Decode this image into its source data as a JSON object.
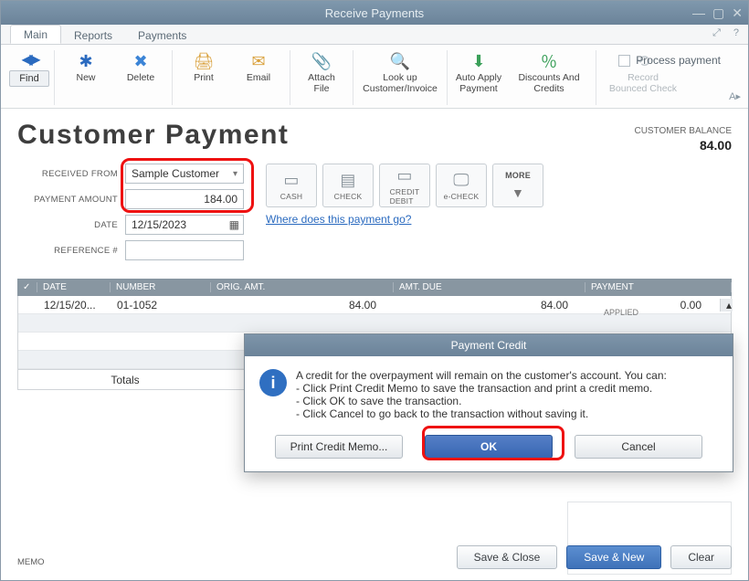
{
  "window": {
    "title": "Receive Payments"
  },
  "tabs": {
    "items": [
      "Main",
      "Reports",
      "Payments"
    ],
    "active": "Main"
  },
  "ribbon": {
    "find": "Find",
    "new": "New",
    "delete": "Delete",
    "print": "Print",
    "email": "Email",
    "attach": "Attach\nFile",
    "lookup": "Look up\nCustomer/Invoice",
    "autoapply": "Auto Apply\nPayment",
    "discounts": "Discounts And\nCredits",
    "record": "Record\nBounced Check",
    "process_payment": "Process payment"
  },
  "header": {
    "title": "Customer Payment",
    "balance_label": "CUSTOMER BALANCE",
    "balance_value": "84.00"
  },
  "form": {
    "received_from_label": "RECEIVED FROM",
    "received_from_value": "Sample Customer",
    "payment_amount_label": "PAYMENT AMOUNT",
    "payment_amount_value": "184.00",
    "date_label": "DATE",
    "date_value": "12/15/2023",
    "reference_label": "REFERENCE #",
    "reference_value": ""
  },
  "pay_methods": {
    "cash": "CASH",
    "check": "CHECK",
    "credit": "CREDIT\nDEBIT",
    "echeck": "e-CHECK",
    "more": "MORE"
  },
  "paylink": "Where does this payment go?",
  "grid": {
    "cols": {
      "check": "✓",
      "date": "DATE",
      "number": "NUMBER",
      "orig": "ORIG. AMT.",
      "due": "AMT. DUE",
      "payment": "PAYMENT"
    },
    "rows": [
      {
        "date": "12/15/20...",
        "number": "01-1052",
        "orig": "84.00",
        "due": "84.00",
        "payment": "0.00"
      }
    ],
    "totals_label": "Totals"
  },
  "summary": {
    "applied_label": "APPLIED"
  },
  "memo": {
    "label": "MEMO",
    "value": ""
  },
  "buttons": {
    "save_close": "Save & Close",
    "save_new": "Save & New",
    "clear": "Clear"
  },
  "modal": {
    "title": "Payment Credit",
    "line1": "A credit for the overpayment will remain on the customer's account.  You can:",
    "bullet1": "- Click Print Credit Memo to save the transaction and print a credit memo.",
    "bullet2": "- Click OK to save the transaction.",
    "bullet3": "- Click Cancel to go back to the transaction without saving it.",
    "print_btn": "Print Credit Memo...",
    "ok_btn": "OK",
    "cancel_btn": "Cancel"
  }
}
